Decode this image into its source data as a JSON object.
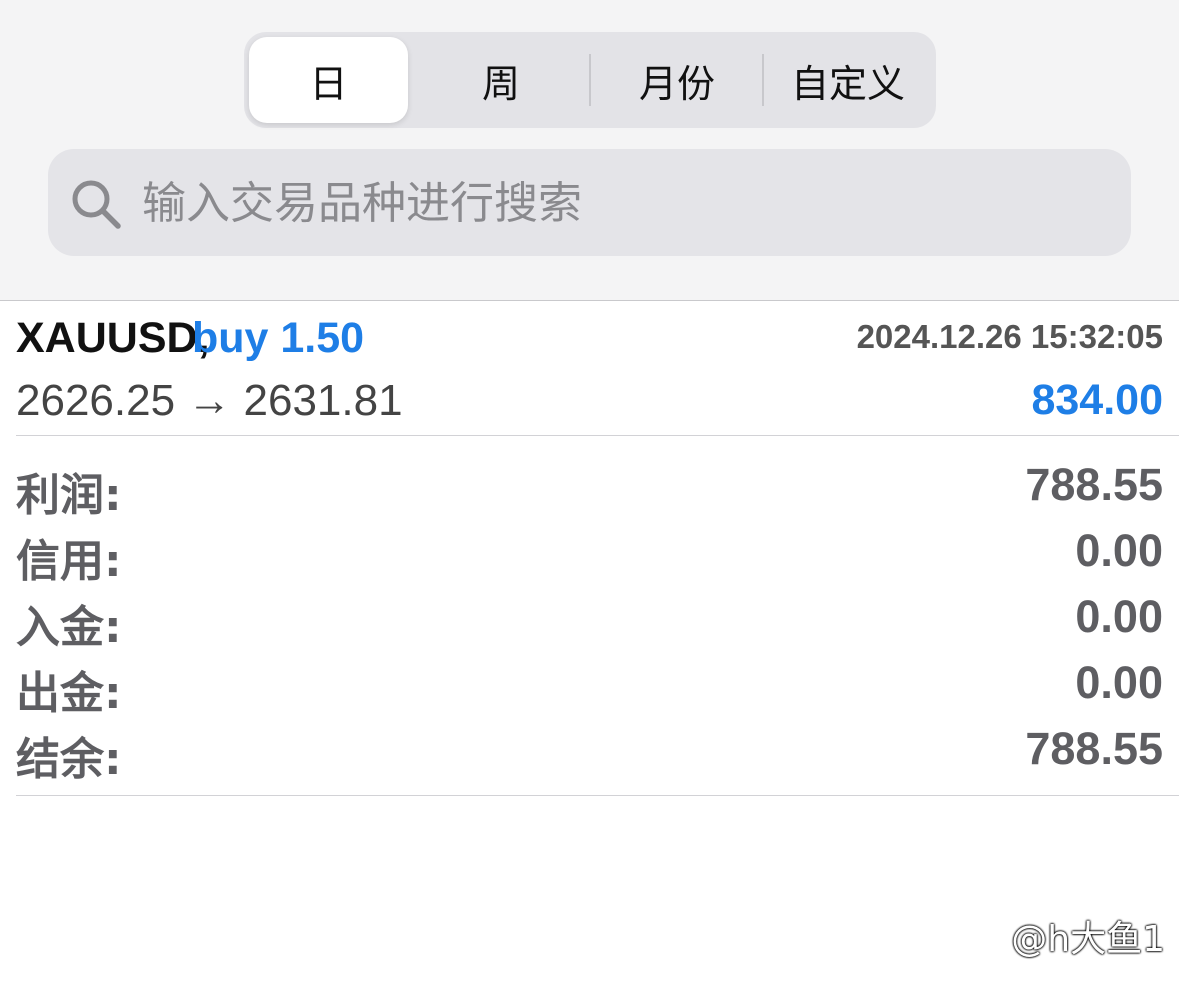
{
  "tabs": [
    {
      "label": "日",
      "active": true
    },
    {
      "label": "周",
      "active": false
    },
    {
      "label": "月份",
      "active": false
    },
    {
      "label": "自定义",
      "active": false
    }
  ],
  "search": {
    "placeholder": "输入交易品种进行搜索",
    "icon": "search-icon"
  },
  "trade": {
    "symbol": "XAUUSD,",
    "side_volume": "buy 1.50",
    "datetime": "2024.12.26 15:32:05",
    "prices": "2626.25 → 2631.81",
    "profit": "834.00"
  },
  "summary": [
    {
      "label": "利润:",
      "value": "788.55"
    },
    {
      "label": "信用:",
      "value": "0.00"
    },
    {
      "label": "入金:",
      "value": "0.00"
    },
    {
      "label": "出金:",
      "value": "0.00"
    },
    {
      "label": "结余:",
      "value": "788.55"
    }
  ],
  "watermark": "@h大鱼1",
  "colors": {
    "accent": "#1e7ee6",
    "label": "#5e5e62",
    "background": "#f4f4f5"
  }
}
